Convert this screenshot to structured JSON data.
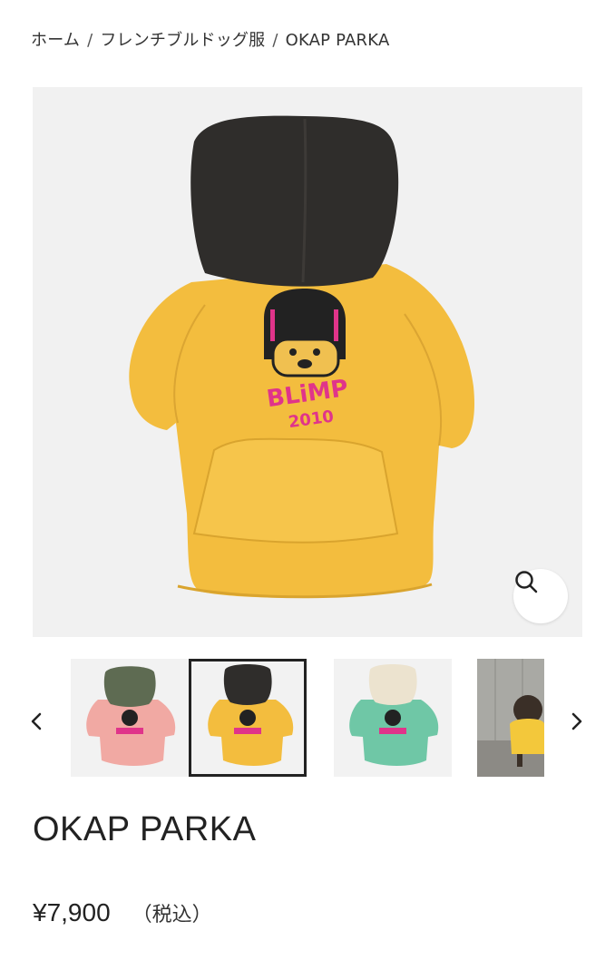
{
  "breadcrumb": {
    "home": "ホーム",
    "separator": "/",
    "category": "フレンチブルドッグ服",
    "current": "OKAP PARKA"
  },
  "main_image": {
    "print_text": "BLiMP",
    "print_year": "2010",
    "hood_color": "#2f2d2b",
    "body_color": "#f3bd3e"
  },
  "thumbnails": [
    {
      "variant": "pink",
      "hood_color": "#5e6b52",
      "body_color": "#f1a9a3",
      "selected": false
    },
    {
      "variant": "yellow",
      "hood_color": "#2f2d2b",
      "body_color": "#f3bd3e",
      "selected": true
    },
    {
      "variant": "mint",
      "hood_color": "#ece3cf",
      "body_color": "#6fc7a6",
      "selected": false
    },
    {
      "variant": "photo",
      "selected": false
    }
  ],
  "product": {
    "title": "OKAP PARKA",
    "price": "¥7,900",
    "tax_note": "（税込）"
  },
  "icons": {
    "zoom": "search-icon",
    "prev": "chevron-left-icon",
    "next": "chevron-right-icon"
  }
}
